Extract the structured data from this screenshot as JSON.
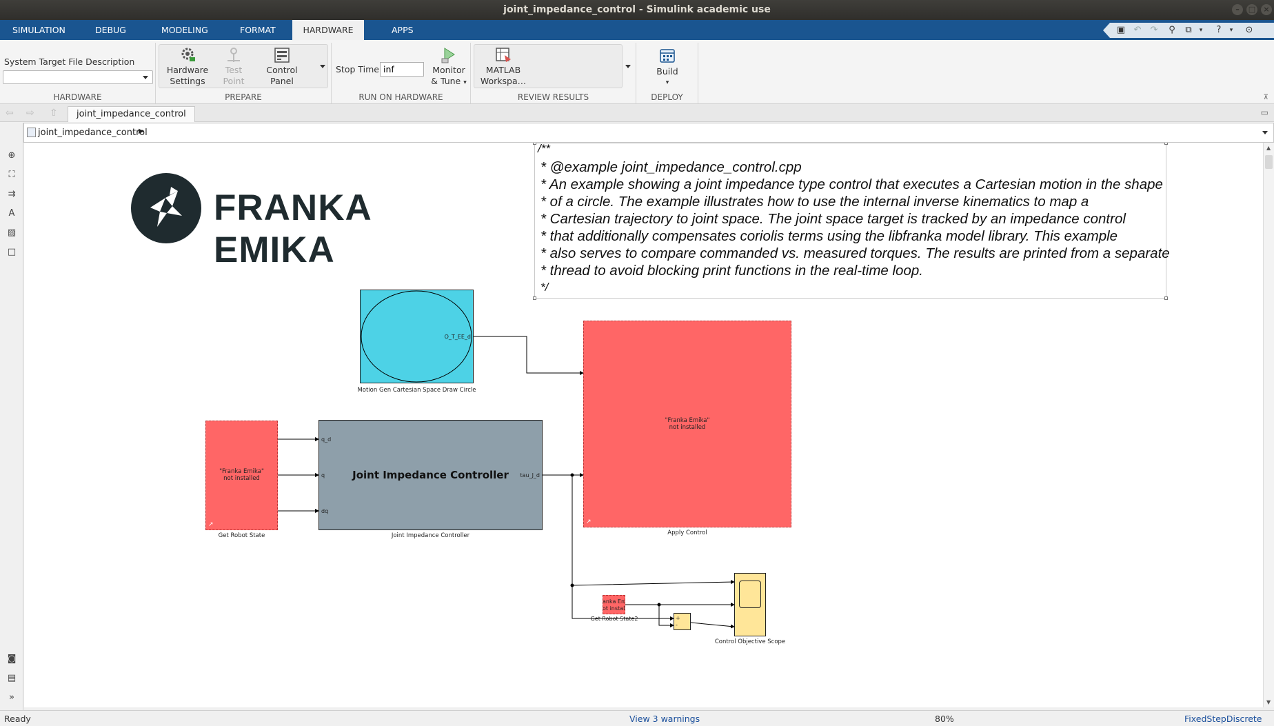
{
  "window": {
    "title": "joint_impedance_control - Simulink academic use"
  },
  "tabs": [
    "SIMULATION",
    "DEBUG",
    "MODELING",
    "FORMAT",
    "HARDWARE",
    "APPS"
  ],
  "ribbon": {
    "hardware": {
      "target_label": "System Target File Description",
      "target_value": "",
      "group_label": "HARDWARE"
    },
    "prepare": {
      "hardware_settings": "Hardware Settings",
      "hardware_settings_l1": "Hardware",
      "hardware_settings_l2": "Settings",
      "test_point_l1": "Test",
      "test_point_l2": "Point",
      "control_panel_l1": "Control",
      "control_panel_l2": "Panel",
      "group_label": "PREPARE"
    },
    "run": {
      "stop_time_label": "Stop Time",
      "stop_time_value": "inf",
      "monitor_l1": "Monitor",
      "monitor_l2": "& Tune",
      "group_label": "RUN ON HARDWARE"
    },
    "review": {
      "matlab_l1": "MATLAB",
      "matlab_l2": "Workspa…",
      "group_label": "REVIEW RESULTS"
    },
    "deploy": {
      "build_label": "Build",
      "group_label": "DEPLOY"
    }
  },
  "doc_tab": "joint_impedance_control",
  "breadcrumb": "joint_impedance_control",
  "model": {
    "logo_text": "FRANKA EMIKA",
    "annotation_lines": [
      "/**",
      "* @example joint_impedance_control.cpp",
      "* An example showing a joint impedance type control that executes a Cartesian motion in the shape",
      "* of a circle. The example illustrates how to use the internal inverse kinematics to map a",
      "* Cartesian trajectory to joint space. The joint space target is tracked by an impedance control",
      "* that additionally compensates coriolis terms using the libfranka model library. This example",
      "* also serves to compare commanded vs. measured torques. The results are printed from a separate",
      "* thread to avoid blocking print functions in the real-time loop.",
      "*/"
    ],
    "motion_gen": {
      "port_out": "O_T_EE_d",
      "label": "Motion Gen Cartesian Space Draw Circle"
    },
    "get_robot_state": {
      "text_l1": "\"Franka Emika\"",
      "text_l2": "not installed",
      "label": "Get Robot State"
    },
    "controller": {
      "title": "Joint Impedance Controller",
      "label": "Joint Impedance Controller",
      "in1": "q_d",
      "in2": "q",
      "in3": "dq",
      "out": "tau_J_d"
    },
    "apply_control": {
      "text_l1": "\"Franka Emika\"",
      "text_l2": "not installed",
      "label": "Apply Control"
    },
    "get_robot_state2": {
      "text_l1": "anka Emi",
      "text_l2": "ot installe",
      "label": "Get Robot State2"
    },
    "sum_block": {
      "plus": "+",
      "minus": "-"
    },
    "scope": {
      "label": "Control Objective Scope"
    }
  },
  "status": {
    "state": "Ready",
    "warnings": "View 3 warnings",
    "zoom": "80%",
    "solver": "FixedStepDiscrete"
  },
  "colors": {
    "tab_strip": "#1a5590",
    "not_installed_block": "#ff6666",
    "motion_gen_block": "#4dd2e6",
    "controller_block": "#8e9faa",
    "scope_block": "#ffe699"
  }
}
